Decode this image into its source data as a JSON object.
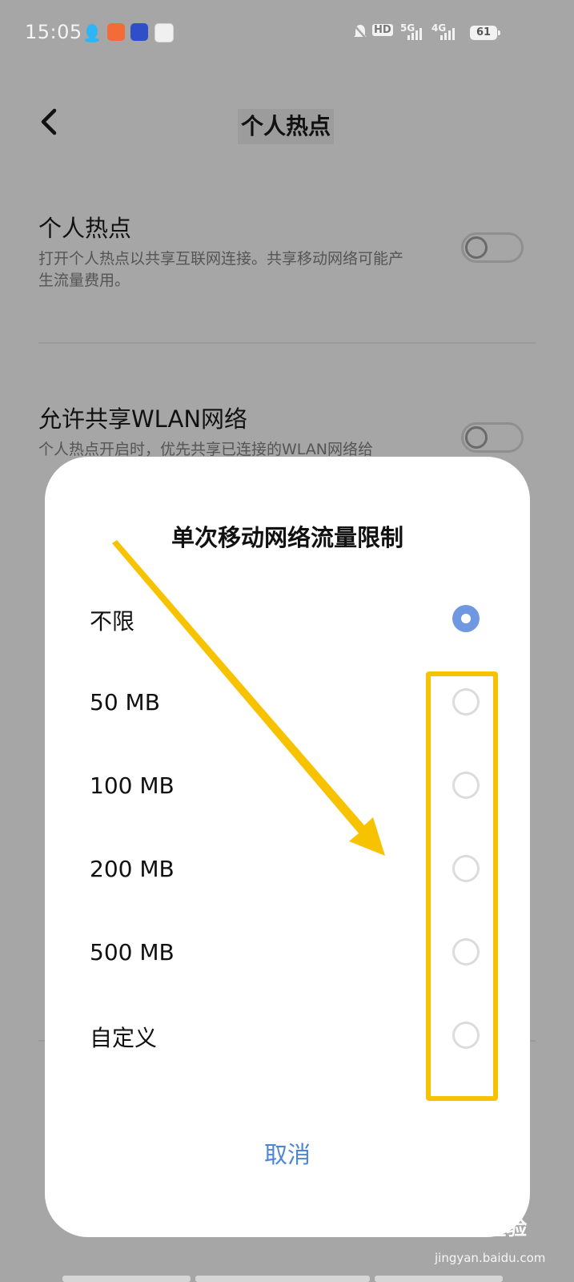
{
  "status_bar": {
    "time": "15:05",
    "hd_label": "HD",
    "net_5g": "5G",
    "net_4g": "4G",
    "battery": "61"
  },
  "header": {
    "title": "个人热点"
  },
  "settings": {
    "hotspot": {
      "title": "个人热点",
      "desc": "打开个人热点以共享互联网连接。共享移动网络可能产生流量费用。",
      "enabled": false
    },
    "wlan_share": {
      "title": "允许共享WLAN网络",
      "desc": "个人热点开启时，优先共享已连接的WLAN网络给",
      "enabled": false
    }
  },
  "dialog": {
    "title": "单次移动网络流量限制",
    "options": [
      {
        "label": "不限",
        "selected": true
      },
      {
        "label": "50 MB",
        "selected": false
      },
      {
        "label": "100 MB",
        "selected": false
      },
      {
        "label": "200 MB",
        "selected": false
      },
      {
        "label": "500 MB",
        "selected": false
      },
      {
        "label": "自定义",
        "selected": false
      }
    ],
    "cancel_label": "取消"
  },
  "watermark": {
    "brand": "Bai· 经验",
    "url": "jingyan.baidu.com"
  },
  "colors": {
    "accent": "#4d86d6",
    "radio_selected": "#6f98e0",
    "highlight": "#f7c300",
    "scrim_bg": "#a6a6a6"
  }
}
